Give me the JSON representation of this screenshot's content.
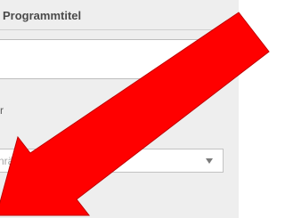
{
  "form": {
    "title_label": "Programmtitel",
    "title_value": "",
    "section_label_fragment": "r",
    "select_placeholder_fragment": "nrä"
  },
  "overlay": {
    "arrow_color": "#ff0000",
    "arrow_outline_color": "#c00000",
    "arrow_icon": "red-arrow-icon"
  }
}
